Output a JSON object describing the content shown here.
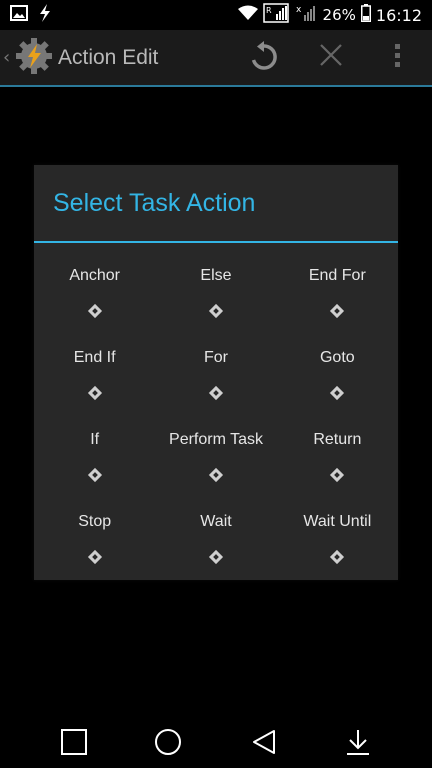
{
  "status_bar": {
    "battery_percent": "26%",
    "time": "16:12",
    "icons": [
      "image-icon",
      "flash-icon",
      "wifi-icon",
      "signal-r-icon",
      "signal-x-icon",
      "battery-icon"
    ]
  },
  "action_bar": {
    "title": "Action Edit",
    "icons": [
      "back-chevron-icon",
      "tasker-logo-icon",
      "undo-icon",
      "close-icon",
      "overflow-menu-icon"
    ]
  },
  "dialog": {
    "title": "Select Task Action",
    "actions": [
      {
        "label": "Anchor",
        "icon": "action-icon"
      },
      {
        "label": "Else",
        "icon": "action-icon"
      },
      {
        "label": "End For",
        "icon": "action-icon"
      },
      {
        "label": "End If",
        "icon": "action-icon"
      },
      {
        "label": "For",
        "icon": "action-icon"
      },
      {
        "label": "Goto",
        "icon": "action-icon"
      },
      {
        "label": "If",
        "icon": "action-icon"
      },
      {
        "label": "Perform Task",
        "icon": "action-icon"
      },
      {
        "label": "Return",
        "icon": "action-icon"
      },
      {
        "label": "Stop",
        "icon": "action-icon"
      },
      {
        "label": "Wait",
        "icon": "action-icon"
      },
      {
        "label": "Wait Until",
        "icon": "action-icon"
      }
    ]
  },
  "nav_bar": {
    "icons": [
      "recents-square-icon",
      "home-circle-icon",
      "back-triangle-icon",
      "download-arrow-icon"
    ]
  },
  "colors": {
    "accent": "#33b5e5",
    "dialog_bg": "#282828",
    "actionbar_bg": "#1b1b1b",
    "background": "#000000"
  }
}
